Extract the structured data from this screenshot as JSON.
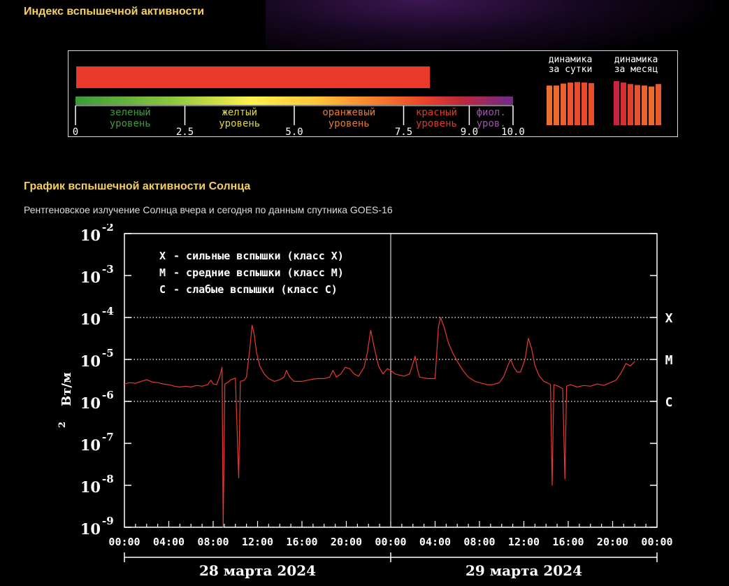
{
  "flare_index": {
    "section_title": "Индекс вспышечной активности",
    "current_value": 8.1,
    "scale": {
      "min": 0,
      "max": 10,
      "ticks": [
        "0",
        "2.5",
        "5.0",
        "7.5",
        "9.0",
        "10.0"
      ],
      "levels": [
        {
          "line1": "зеленый",
          "line2": "уровень",
          "color": "#3e9b3e"
        },
        {
          "line1": "желтый",
          "line2": "уровень",
          "color": "#e0d640"
        },
        {
          "line1": "оранжевый",
          "line2": "уровень",
          "color": "#e47a32"
        },
        {
          "line1": "красный",
          "line2": "уровень",
          "color": "#e03a2c"
        },
        {
          "line1": "фиол.",
          "line2": "уров.",
          "color": "#9a55a8"
        }
      ]
    },
    "bar_color": "#e8392a",
    "dynamics_day": {
      "line1": "динамика",
      "line2": "за сутки",
      "values": [
        8.1,
        8.1,
        8.5,
        8.7,
        8.8,
        8.7,
        8.6
      ],
      "colors": [
        "#ed6f2f",
        "#ed6a2f",
        "#ec5f2f",
        "#eb542d",
        "#ea4a2c",
        "#ea4b2c",
        "#ea4f2c"
      ]
    },
    "dynamics_month": {
      "line1": "динамика",
      "line2": "за месяц",
      "values": [
        9.0,
        8.7,
        8.4,
        8.2,
        8.1,
        7.9,
        8.4
      ],
      "colors": [
        "#c8243c",
        "#d62f33",
        "#e0412e",
        "#e55430",
        "#ea642f",
        "#ec6c2f",
        "#ea5a2e"
      ]
    }
  },
  "xray_chart": {
    "section_title": "График вспышечной активности Солнца",
    "subtitle": "Рентгеновское излучение Солнца вчера и сегодня по данным спутника GOES-16"
  },
  "chart_data": {
    "type": "line",
    "ylabel": "Вт/м",
    "ylabel_sup": "2",
    "y_scale": "log",
    "ylim": [
      1e-09,
      0.01
    ],
    "y_ticks": [
      {
        "value": 0.01,
        "base": "10",
        "exp": "-2"
      },
      {
        "value": 0.001,
        "base": "10",
        "exp": "-3"
      },
      {
        "value": 0.0001,
        "base": "10",
        "exp": "-4"
      },
      {
        "value": 1e-05,
        "base": "10",
        "exp": "-5"
      },
      {
        "value": 1e-06,
        "base": "10",
        "exp": "-6"
      },
      {
        "value": 1e-07,
        "base": "10",
        "exp": "-7"
      },
      {
        "value": 1e-08,
        "base": "10",
        "exp": "-8"
      },
      {
        "value": 1e-09,
        "base": "10",
        "exp": "-9"
      }
    ],
    "xlim": [
      0,
      48
    ],
    "x_ticks": [
      "00:00",
      "04:00",
      "08:00",
      "12:00",
      "16:00",
      "20:00",
      "00:00",
      "04:00",
      "08:00",
      "12:00",
      "16:00",
      "20:00",
      "00:00"
    ],
    "x_tick_hours": [
      0,
      4,
      8,
      12,
      16,
      20,
      24,
      28,
      32,
      36,
      40,
      44,
      48
    ],
    "day_divider_hour": 24,
    "date_labels": [
      {
        "text": "28 марта 2024",
        "center_hour": 12
      },
      {
        "text": "29 марта 2024",
        "center_hour": 36
      }
    ],
    "class_levels": [
      {
        "label": "X",
        "value": 0.0001
      },
      {
        "label": "M",
        "value": 1e-05
      },
      {
        "label": "C",
        "value": 1e-06
      }
    ],
    "legend": [
      {
        "key": "X",
        "text": "- сильные вспышки (класс X)"
      },
      {
        "key": "M",
        "text": "- средние вспышки (класс M)"
      },
      {
        "key": "C",
        "text": "- слабые вспышки (класс C)"
      }
    ],
    "grid": "dotted class levels only",
    "series": [
      {
        "color": "#e83a30",
        "points": [
          [
            0.0,
            2.6e-06
          ],
          [
            0.5,
            2.8e-06
          ],
          [
            1.0,
            2.7e-06
          ],
          [
            1.5,
            3e-06
          ],
          [
            2.0,
            3.3e-06
          ],
          [
            2.5,
            2.9e-06
          ],
          [
            3.0,
            2.8e-06
          ],
          [
            3.5,
            2.6e-06
          ],
          [
            4.0,
            2.5e-06
          ],
          [
            4.5,
            2.3e-06
          ],
          [
            5.0,
            2.2e-06
          ],
          [
            5.5,
            2.3e-06
          ],
          [
            6.0,
            2.2e-06
          ],
          [
            6.5,
            2.4e-06
          ],
          [
            7.0,
            2.3e-06
          ],
          [
            7.5,
            2.5e-06
          ],
          [
            7.8,
            3.2e-06
          ],
          [
            8.0,
            2.6e-06
          ],
          [
            8.3,
            2.5e-06
          ],
          [
            8.6,
            4e-06
          ],
          [
            8.8,
            6.5e-06
          ],
          [
            8.9,
            1e-09
          ],
          [
            9.05,
            2.6e-06
          ],
          [
            9.3,
            2.8e-06
          ],
          [
            9.6,
            3.3e-06
          ],
          [
            10.0,
            3.6e-06
          ],
          [
            10.3,
            1.5e-08
          ],
          [
            10.45,
            3e-06
          ],
          [
            10.8,
            3.2e-06
          ],
          [
            11.0,
            3.8e-06
          ],
          [
            11.3,
            1.8e-05
          ],
          [
            11.5,
            6.5e-05
          ],
          [
            11.7,
            4e-05
          ],
          [
            11.9,
            1.5e-05
          ],
          [
            12.2,
            7e-06
          ],
          [
            12.6,
            4.5e-06
          ],
          [
            13.0,
            3.5e-06
          ],
          [
            13.5,
            3e-06
          ],
          [
            14.0,
            3.3e-06
          ],
          [
            14.4,
            3.8e-06
          ],
          [
            14.6,
            5.5e-06
          ],
          [
            14.9,
            3.8e-06
          ],
          [
            15.3,
            3e-06
          ],
          [
            16.0,
            3e-06
          ],
          [
            16.5,
            3.2e-06
          ],
          [
            17.0,
            3.4e-06
          ],
          [
            17.5,
            3.5e-06
          ],
          [
            18.0,
            3.5e-06
          ],
          [
            18.5,
            3.8e-06
          ],
          [
            18.8,
            5.5e-06
          ],
          [
            19.1,
            3.8e-06
          ],
          [
            19.5,
            4.5e-06
          ],
          [
            19.9,
            6.5e-06
          ],
          [
            20.3,
            6e-06
          ],
          [
            20.7,
            4.5e-06
          ],
          [
            21.1,
            4e-06
          ],
          [
            21.6,
            6.5e-06
          ],
          [
            21.9,
            1.5e-05
          ],
          [
            22.2,
            5e-05
          ],
          [
            22.5,
            2e-05
          ],
          [
            22.9,
            7e-06
          ],
          [
            23.3,
            4.5e-06
          ],
          [
            23.7,
            6e-06
          ],
          [
            24.0,
            5.5e-06
          ],
          [
            24.4,
            4.5e-06
          ],
          [
            25.2,
            4e-06
          ],
          [
            25.7,
            4.5e-06
          ],
          [
            26.0,
            8e-06
          ],
          [
            26.2,
            1.2e-05
          ],
          [
            26.4,
            6e-06
          ],
          [
            26.6,
            3.8e-06
          ],
          [
            27.3,
            3.5e-06
          ],
          [
            28.0,
            3.5e-06
          ],
          [
            28.3,
            6e-05
          ],
          [
            28.5,
            0.0001
          ],
          [
            28.8,
            6e-05
          ],
          [
            29.2,
            2.5e-05
          ],
          [
            29.6,
            1.4e-05
          ],
          [
            30.0,
            9e-06
          ],
          [
            30.5,
            5.5e-06
          ],
          [
            31.0,
            3.8e-06
          ],
          [
            31.6,
            3e-06
          ],
          [
            32.2,
            2.7e-06
          ],
          [
            32.7,
            2.5e-06
          ],
          [
            33.2,
            2.5e-06
          ],
          [
            33.8,
            2.8e-06
          ],
          [
            34.2,
            4e-06
          ],
          [
            34.5,
            6.5e-06
          ],
          [
            34.8,
            1e-05
          ],
          [
            35.1,
            6.5e-06
          ],
          [
            35.4,
            5e-06
          ],
          [
            35.7,
            5e-06
          ],
          [
            36.1,
            1e-05
          ],
          [
            36.4,
            3.2e-05
          ],
          [
            36.7,
            1.8e-05
          ],
          [
            37.0,
            7e-06
          ],
          [
            37.4,
            4e-06
          ],
          [
            37.8,
            3e-06
          ],
          [
            38.2,
            2.7e-06
          ],
          [
            38.4,
            2.5e-06
          ],
          [
            38.55,
            1e-08
          ],
          [
            38.7,
            2.5e-06
          ],
          [
            39.1,
            2.3e-06
          ],
          [
            39.5,
            2e-06
          ],
          [
            39.7,
            1.4e-08
          ],
          [
            39.85,
            2.3e-06
          ],
          [
            40.2,
            2.5e-06
          ],
          [
            40.8,
            2.2e-06
          ],
          [
            41.4,
            2.4e-06
          ],
          [
            42.0,
            2.3e-06
          ],
          [
            42.6,
            2.6e-06
          ],
          [
            43.2,
            2.4e-06
          ],
          [
            43.8,
            2.8e-06
          ],
          [
            44.3,
            3.2e-06
          ],
          [
            44.8,
            5e-06
          ],
          [
            45.2,
            8e-06
          ],
          [
            45.6,
            7e-06
          ],
          [
            46.0,
            9e-06
          ]
        ]
      }
    ]
  }
}
